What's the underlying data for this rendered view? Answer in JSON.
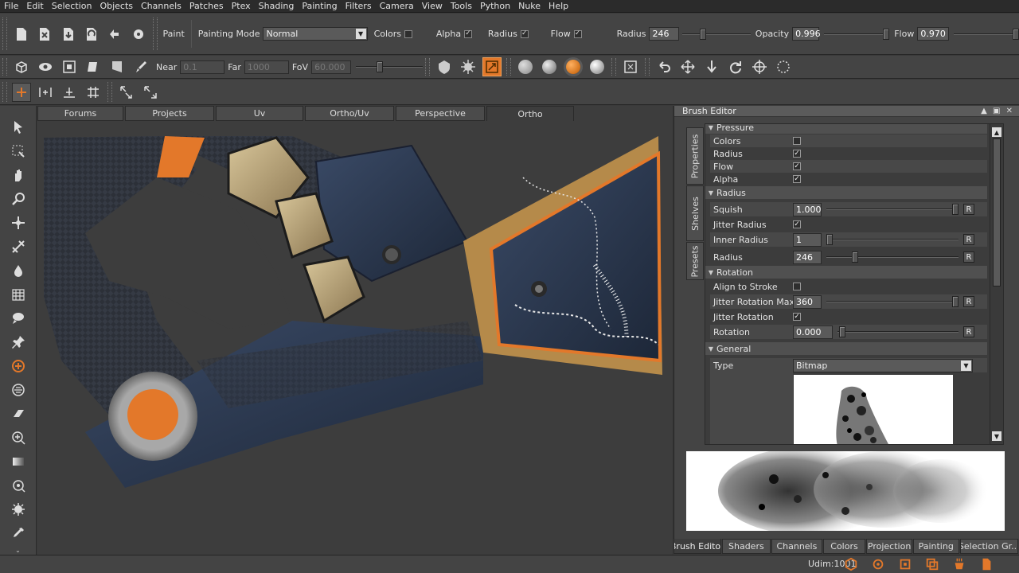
{
  "menu": [
    "File",
    "Edit",
    "Selection",
    "Objects",
    "Channels",
    "Patches",
    "Ptex",
    "Shading",
    "Painting",
    "Filters",
    "Camera",
    "View",
    "Tools",
    "Python",
    "Nuke",
    "Help"
  ],
  "toolbar": {
    "paint_label": "Paint",
    "painting_mode_label": "Painting Mode",
    "painting_mode_value": "Normal",
    "colors_label": "Colors",
    "alpha_label": "Alpha",
    "radius_cb_label": "Radius",
    "flow_cb_label": "Flow",
    "radius_label": "Radius",
    "radius_value": "246",
    "opacity_label": "Opacity",
    "opacity_value": "0.996",
    "flow_label": "Flow",
    "flow_value": "0.970"
  },
  "camera": {
    "near_label": "Near",
    "near_value": "0.1",
    "far_label": "Far",
    "far_value": "1000",
    "fov_label": "FoV",
    "fov_value": "60.000"
  },
  "viewport_tabs": [
    "Forums",
    "Projects",
    "Uv",
    "Ortho/Uv",
    "Perspective",
    "Ortho"
  ],
  "brush_editor": {
    "title": "Brush Editor",
    "side_tabs": [
      "Properties",
      "Shelves",
      "Presets"
    ],
    "pressure_header": "Pressure",
    "pressure_rows": [
      {
        "label": "Colors",
        "checked": false
      },
      {
        "label": "Radius",
        "checked": true
      },
      {
        "label": "Flow",
        "checked": true
      },
      {
        "label": "Alpha",
        "checked": true
      }
    ],
    "radius_section": "Radius",
    "squish_label": "Squish",
    "squish_value": "1.000",
    "jitter_radius_label": "Jitter Radius",
    "inner_radius_label": "Inner Radius",
    "inner_radius_value": "1",
    "radius_label": "Radius",
    "radius_value": "246",
    "rotation_section": "Rotation",
    "align_label": "Align to Stroke",
    "jitter_rot_max_label": "Jitter Rotation Max",
    "jitter_rot_max_value": "360",
    "jitter_rotation_label": "Jitter Rotation",
    "rotation_label": "Rotation",
    "rotation_value": "0.000",
    "general_section": "General",
    "type_label": "Type",
    "type_value": "Bitmap",
    "reset_label": "R"
  },
  "bottom_tabs": [
    "Brush Editor",
    "Shaders",
    "Channels",
    "Colors",
    "Projection",
    "Painting",
    "Selection Gr..."
  ],
  "status": {
    "udim": "Udim:1001"
  }
}
